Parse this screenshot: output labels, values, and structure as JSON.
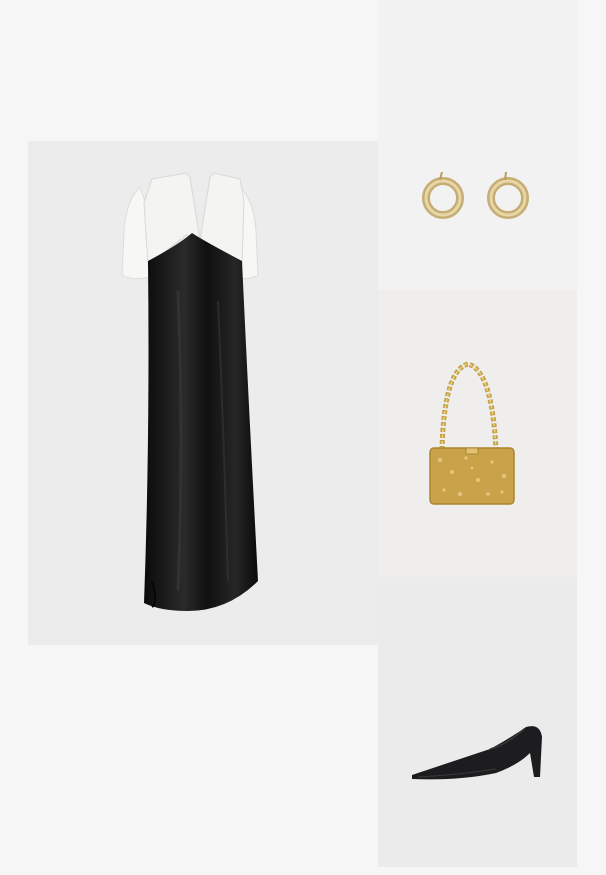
{
  "items": [
    {
      "id": "dress",
      "icon": "dress-image"
    },
    {
      "id": "earrings",
      "icon": "earrings-image"
    },
    {
      "id": "bag",
      "icon": "handbag-image"
    },
    {
      "id": "shoes",
      "icon": "pumps-image"
    }
  ],
  "colors": {
    "page_background": "#f6f6f6",
    "dress_satin": "#121212",
    "dress_top": "#f4f4f2",
    "gold": "#c9a24a",
    "gold_light": "#e6cf86",
    "leather": "#1d1d1f"
  }
}
